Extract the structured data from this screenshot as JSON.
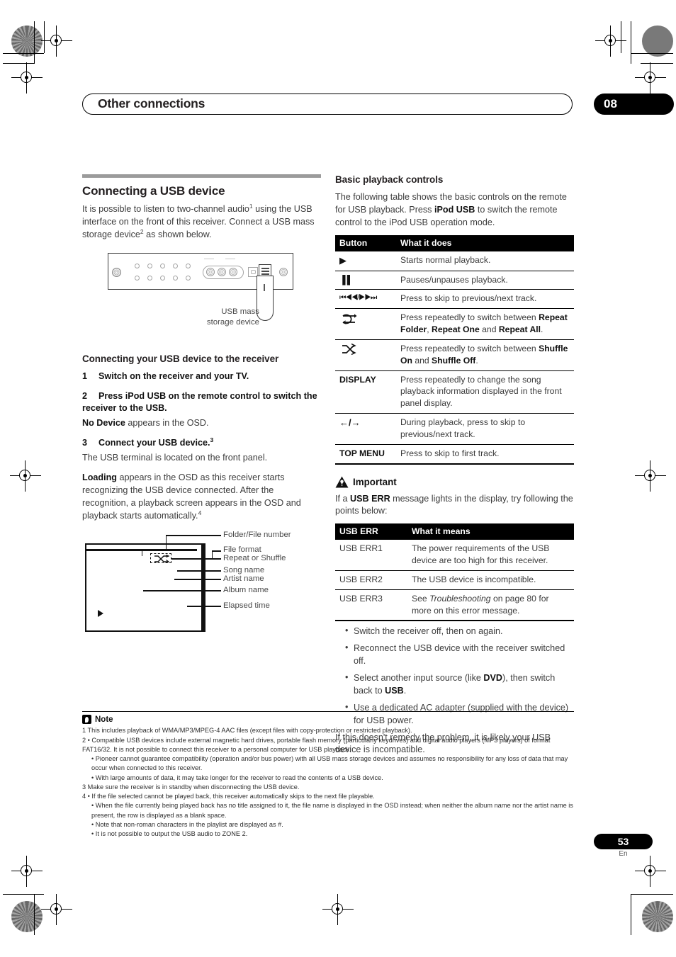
{
  "header": {
    "chapter_title": "Other connections",
    "chapter_number": "08"
  },
  "left_column": {
    "section_title": "Connecting a USB device",
    "intro_line1_a": "It is possible to listen to two-channel audio",
    "intro_line1_sup": "1",
    "intro_line1_b": " using the USB interface on the front of this receiver. Connect a USB mass storage device",
    "intro_line1_sup2": "2",
    "intro_line1_c": " as shown below.",
    "figure_panel_caption_line1": "USB mass",
    "figure_panel_caption_line2": "storage device",
    "subsection_title": "Connecting your USB device to the receiver",
    "steps": [
      {
        "number": "1",
        "title": "Switch on the receiver and your TV.",
        "body": ""
      },
      {
        "number": "2",
        "title": "Press iPod USB on the remote control to switch the receiver to the USB.",
        "body_bold": "No Device",
        "body": " appears in the OSD."
      },
      {
        "number": "3",
        "title": "Connect your USB device.",
        "title_sup": "3",
        "body": "The USB terminal is located on the front panel."
      }
    ],
    "loading_bold": "Loading",
    "loading_text": " appears in the OSD as this receiver starts recognizing the USB device connected. After the recognition, a playback screen appears in the OSD and playback starts automatically.",
    "loading_sup": "4",
    "osd_labels": [
      "Folder/File number",
      "File format",
      "Repeat or Shuffle",
      "Song name",
      "Artist name",
      "Album name",
      "Elapsed time"
    ]
  },
  "right_column": {
    "section_title": "Basic playback controls",
    "intro_a": "The following table shows the basic controls on the remote for USB playback. Press ",
    "intro_bold": "iPod USB",
    "intro_b": " to switch the remote control to the iPod USB operation mode.",
    "controls_table": {
      "headers": [
        "Button",
        "What it does"
      ],
      "rows": [
        {
          "button": "play-icon",
          "button_label": "▶",
          "desc": "Starts normal playback."
        },
        {
          "button": "pause-icon",
          "button_label": "▐▐",
          "desc": "Pauses/unpauses playback."
        },
        {
          "button": "prev-next-icon",
          "button_label": "⏮◀◀/▶▶⏭",
          "desc": "Press to skip to previous/next track."
        },
        {
          "button": "repeat-icon",
          "button_label": "",
          "desc_parts": [
            "Press repeatedly to switch between ",
            "Repeat Folder",
            ", ",
            "Repeat One",
            " and ",
            "Repeat All",
            "."
          ]
        },
        {
          "button": "shuffle-icon",
          "button_label": "",
          "desc_parts": [
            "Press repeatedly to switch between ",
            "Shuffle On",
            " and ",
            "Shuffle Off",
            "."
          ]
        },
        {
          "button": "display-text",
          "button_label": "DISPLAY",
          "desc": "Press repeatedly to change the song playback information displayed in the front panel display."
        },
        {
          "button": "left-right-arrows-icon",
          "button_label": "←/→",
          "desc": "During playback, press to skip to previous/next track."
        },
        {
          "button": "top-menu-text",
          "button_label": "TOP MENU",
          "desc": "Press to skip to first track."
        }
      ]
    },
    "important_label": "Important",
    "important_intro_a": "If a ",
    "important_intro_bold": "USB ERR",
    "important_intro_b": " message lights in the display, try following the points below:",
    "err_table": {
      "headers": [
        "USB ERR",
        "What it means"
      ],
      "rows": [
        {
          "code": "USB ERR1",
          "meaning": "The power requirements of the USB device are too high for this receiver."
        },
        {
          "code": "USB ERR2",
          "meaning": "The USB device is incompatible."
        },
        {
          "code": "USB ERR3",
          "meaning_a": "See ",
          "meaning_i": "Troubleshooting",
          "meaning_b": " on page 80 for more on this error message."
        }
      ]
    },
    "bullets": [
      {
        "text": "Switch the receiver off, then on again."
      },
      {
        "text": "Reconnect the USB device with the receiver switched off."
      },
      {
        "a": "Select another input source (like ",
        "b1": "DVD",
        "c": "), then switch back to ",
        "b2": "USB",
        "d": "."
      },
      {
        "text": "Use a dedicated AC adapter (supplied with the device) for USB power."
      }
    ],
    "closing": "If this doesn't remedy the problem, it is likely your USB device is incompatible."
  },
  "notes": {
    "title": "Note",
    "lines": [
      {
        "indent": false,
        "text": "1 This includes playback of WMA/MP3/MPEG-4 AAC files (except files with copy-protection or restricted playback)."
      },
      {
        "indent": false,
        "text": "2 • Compatible USB devices include external magnetic hard drives, portable flash memory (particularly keydrives) and digital audio players (MP3 players) of format FAT16/32. It is not possible to connect this receiver to a personal computer for USB playback."
      },
      {
        "indent": true,
        "text": "• Pioneer cannot guarantee compatibility (operation and/or bus power) with all USB mass storage devices and assumes no responsibility for any loss of data that may occur when connected to this receiver."
      },
      {
        "indent": true,
        "text": "• With large amounts of data, it may take longer for the receiver to read the contents of a USB device."
      },
      {
        "indent": false,
        "text": "3 Make sure the receiver is in standby when disconnecting the USB device."
      },
      {
        "indent": false,
        "text": "4 • If the file selected cannot be played back, this receiver automatically skips to the next file playable."
      },
      {
        "indent": true,
        "text": "• When the file currently being played back has no title assigned to it, the file name is displayed in the OSD instead; when neither the album name nor the artist name is present, the row is displayed as a blank space."
      },
      {
        "indent": true,
        "text": "• Note that non-roman characters in the playlist are displayed as #."
      },
      {
        "indent": true,
        "text": "• It is not possible to output the USB audio to ZONE 2."
      }
    ]
  },
  "footer": {
    "page_number": "53",
    "language": "En"
  }
}
